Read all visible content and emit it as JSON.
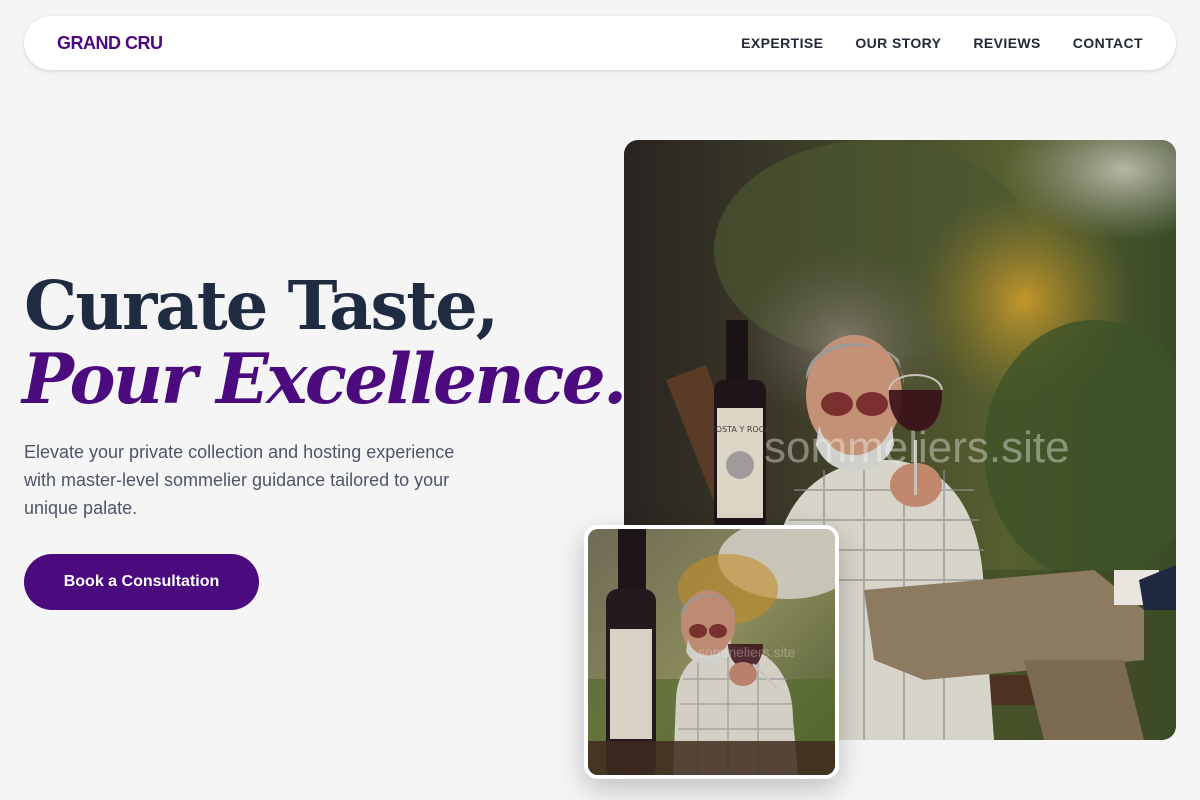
{
  "nav": {
    "brand": "GRAND CRU",
    "items": [
      "EXPERTISE",
      "OUR STORY",
      "REVIEWS",
      "CONTACT"
    ]
  },
  "hero": {
    "title_line1": "Curate Taste,",
    "title_line2": "Pour Excellence.",
    "description": "Elevate your private collection and hosting experience with master-level sommelier guidance tailored to your unique palate.",
    "cta_label": "Book a Consultation"
  },
  "images": {
    "watermark": "sommeliers.site",
    "bottle_label": "COSTA Y ROCA"
  },
  "colors": {
    "accent": "#4b0a7e",
    "heading": "#1e2b40",
    "background": "#f5f5f6"
  }
}
